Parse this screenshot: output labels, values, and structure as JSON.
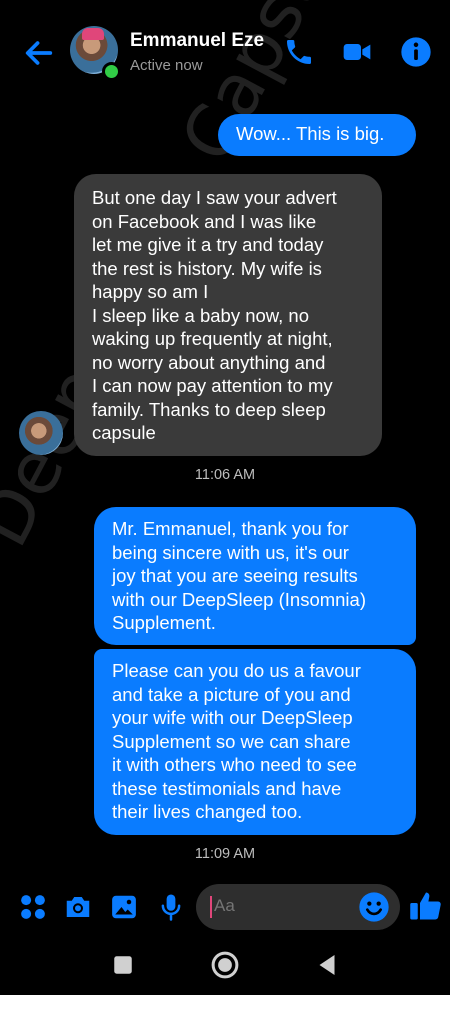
{
  "header": {
    "contact_name": "Emmanuel Eze",
    "status": "Active now",
    "icons": [
      "back-arrow-icon",
      "phone-icon",
      "video-camera-icon",
      "info-icon"
    ]
  },
  "messages": [
    {
      "direction": "sent",
      "text": "Wow... This is big."
    },
    {
      "direction": "received",
      "text": "But one day I saw your advert\non Facebook and I was like\nlet me give it a try and today\nthe rest is history. My wife is\nhappy so am I\nI sleep like a baby now, no\nwaking up frequently at night,\nno worry about anything and\nI can now pay attention to my\nfamily. Thanks to deep sleep\ncapsule"
    },
    {
      "direction": "sent",
      "text": "Mr. Emmanuel, thank you for\nbeing sincere with us, it's our\njoy that you are seeing results\nwith our DeepSleep (Insomnia)\nSupplement."
    },
    {
      "direction": "sent",
      "text": "Please can you do us a favour\nand take a picture of you and\nyour wife with our DeepSleep\nSupplement so we can share\nit with others who need to see\nthese testimonials and have\ntheir lives changed too."
    }
  ],
  "timestamps": [
    "11:06 AM",
    "11:09 AM"
  ],
  "watermark": "Deep Sleep Capsules",
  "composer": {
    "placeholder": "Aa",
    "icons": [
      "menu-grid-icon",
      "camera-icon",
      "gallery-icon",
      "microphone-icon",
      "emoji-icon",
      "thumbs-up-icon"
    ]
  },
  "colors": {
    "accent": "#0a7cff",
    "received_bubble": "#3a3a3a",
    "background": "#000000",
    "online": "#31cc46"
  }
}
